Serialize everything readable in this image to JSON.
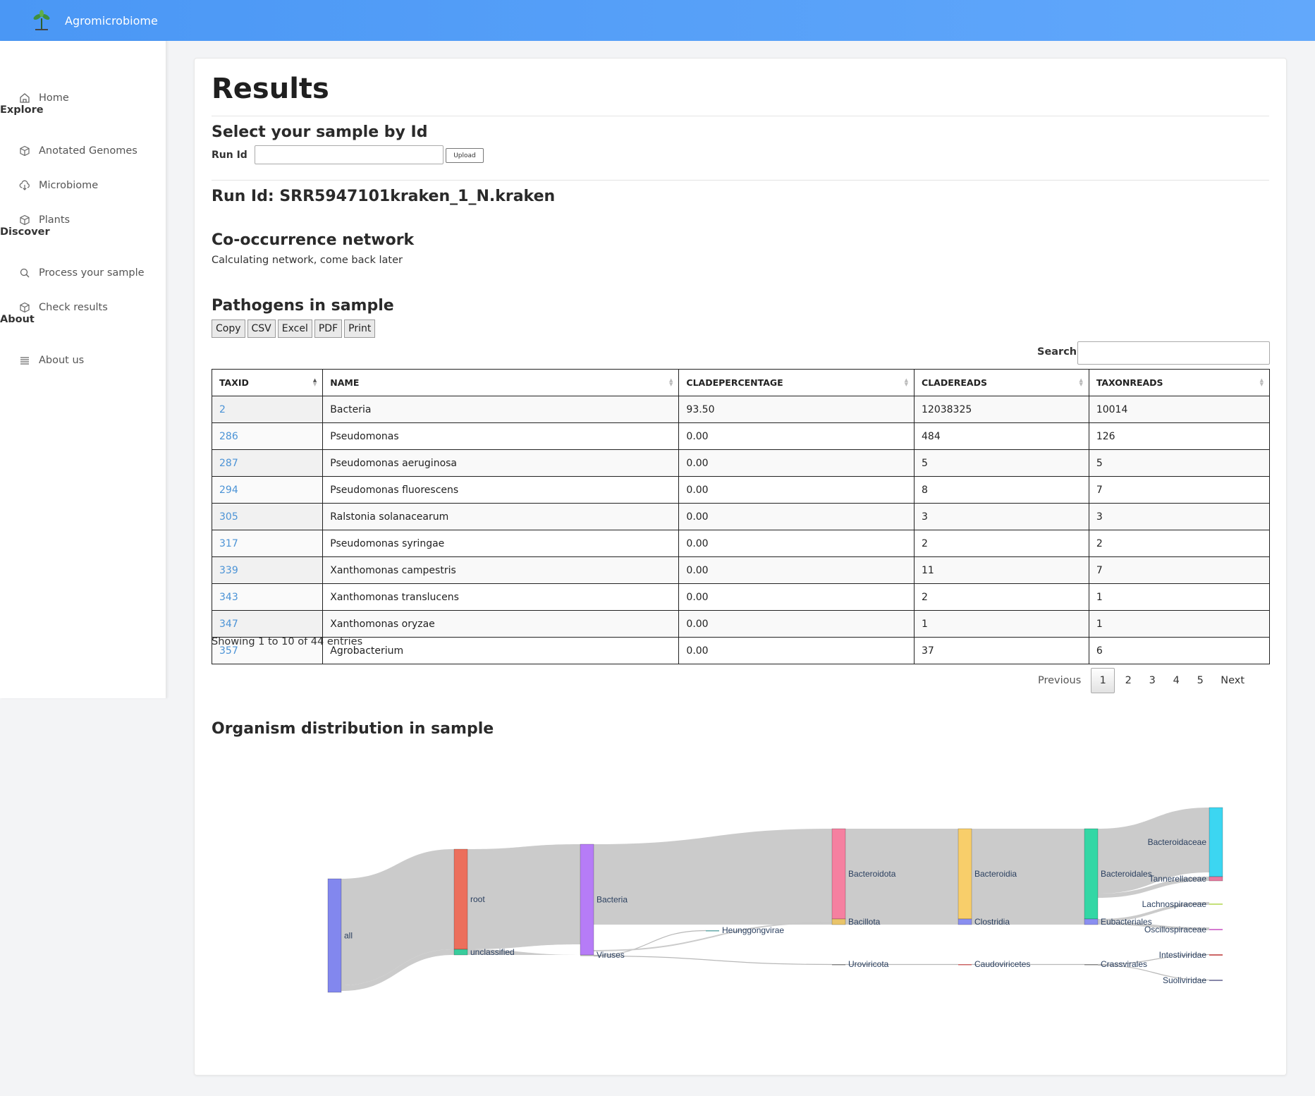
{
  "app": {
    "title": "Agromicrobiome"
  },
  "sidebar": {
    "home": "Home",
    "sections": {
      "explore": "Explore",
      "discover": "Discover",
      "about": "About"
    },
    "items": [
      {
        "label": "Anotated Genomes",
        "icon": "cube-icon"
      },
      {
        "label": "Microbiome",
        "icon": "cloud-download-icon"
      },
      {
        "label": "Plants",
        "icon": "cube-icon"
      },
      {
        "label": "Process your sample",
        "icon": "search-icon"
      },
      {
        "label": "Check results",
        "icon": "cube-icon"
      },
      {
        "label": "About us",
        "icon": "list-icon"
      }
    ]
  },
  "page": {
    "title": "Results",
    "select_heading": "Select your sample by Id",
    "run_id_label": "Run Id",
    "run_id_value": "",
    "upload_label": "Upload",
    "run_heading": "Run Id: SRR5947101kraken_1_N.kraken",
    "network_heading": "Co-occurrence network",
    "network_status": "Calculating network, come back later",
    "pathogens_heading": "Pathogens in sample",
    "distribution_heading": "Organism distribution in sample"
  },
  "table": {
    "export_buttons": [
      "Copy",
      "CSV",
      "Excel",
      "PDF",
      "Print"
    ],
    "search_label": "Search:",
    "search_value": "",
    "columns": [
      "TAXID",
      "NAME",
      "CLADEPERCENTAGE",
      "CLADEREADS",
      "TAXONREADS"
    ],
    "rows": [
      [
        "2",
        "Bacteria",
        "93.50",
        "12038325",
        "10014"
      ],
      [
        "286",
        "Pseudomonas",
        "0.00",
        "484",
        "126"
      ],
      [
        "287",
        "Pseudomonas aeruginosa",
        "0.00",
        "5",
        "5"
      ],
      [
        "294",
        "Pseudomonas fluorescens",
        "0.00",
        "8",
        "7"
      ],
      [
        "305",
        "Ralstonia solanacearum",
        "0.00",
        "3",
        "3"
      ],
      [
        "317",
        "Pseudomonas syringae",
        "0.00",
        "2",
        "2"
      ],
      [
        "339",
        "Xanthomonas campestris",
        "0.00",
        "11",
        "7"
      ],
      [
        "343",
        "Xanthomonas translucens",
        "0.00",
        "2",
        "1"
      ],
      [
        "347",
        "Xanthomonas oryzae",
        "0.00",
        "1",
        "1"
      ],
      [
        "357",
        "Agrobacterium",
        "0.00",
        "37",
        "6"
      ]
    ],
    "info": "Showing 1 to 10 of 44 entries",
    "pagination": {
      "previous": "Previous",
      "pages": [
        "1",
        "2",
        "3",
        "4",
        "5"
      ],
      "current": "1",
      "next": "Next"
    }
  },
  "sankey": {
    "nodes": [
      "all",
      "root",
      "unclassified",
      "Bacteria",
      "Viruses",
      "Heunggongvirae",
      "Bacteroidota",
      "Bacillota",
      "Uroviricota",
      "Bacteroidia",
      "Clostridia",
      "Caudoviricetes",
      "Bacteroidales",
      "Eubacteriales",
      "Crassvirales",
      "Bacteroidaceae",
      "Tannerellaceae",
      "Lachnospiraceae",
      "Oscillospiraceae",
      "Intestiviridae",
      "Suoliviridae"
    ],
    "colors": {
      "all": "#8287ee",
      "root": "#ec6f5c",
      "unclassified": "#39cc9c",
      "Bacteria": "#b67cf7",
      "Bacteroidota": "#f580a0",
      "Bacteroidia": "#f8ce6a",
      "Bacteroidales": "#33d7a5",
      "Bacteroidaceae": "#3cd6f1",
      "link": "#c8c8c8"
    }
  }
}
